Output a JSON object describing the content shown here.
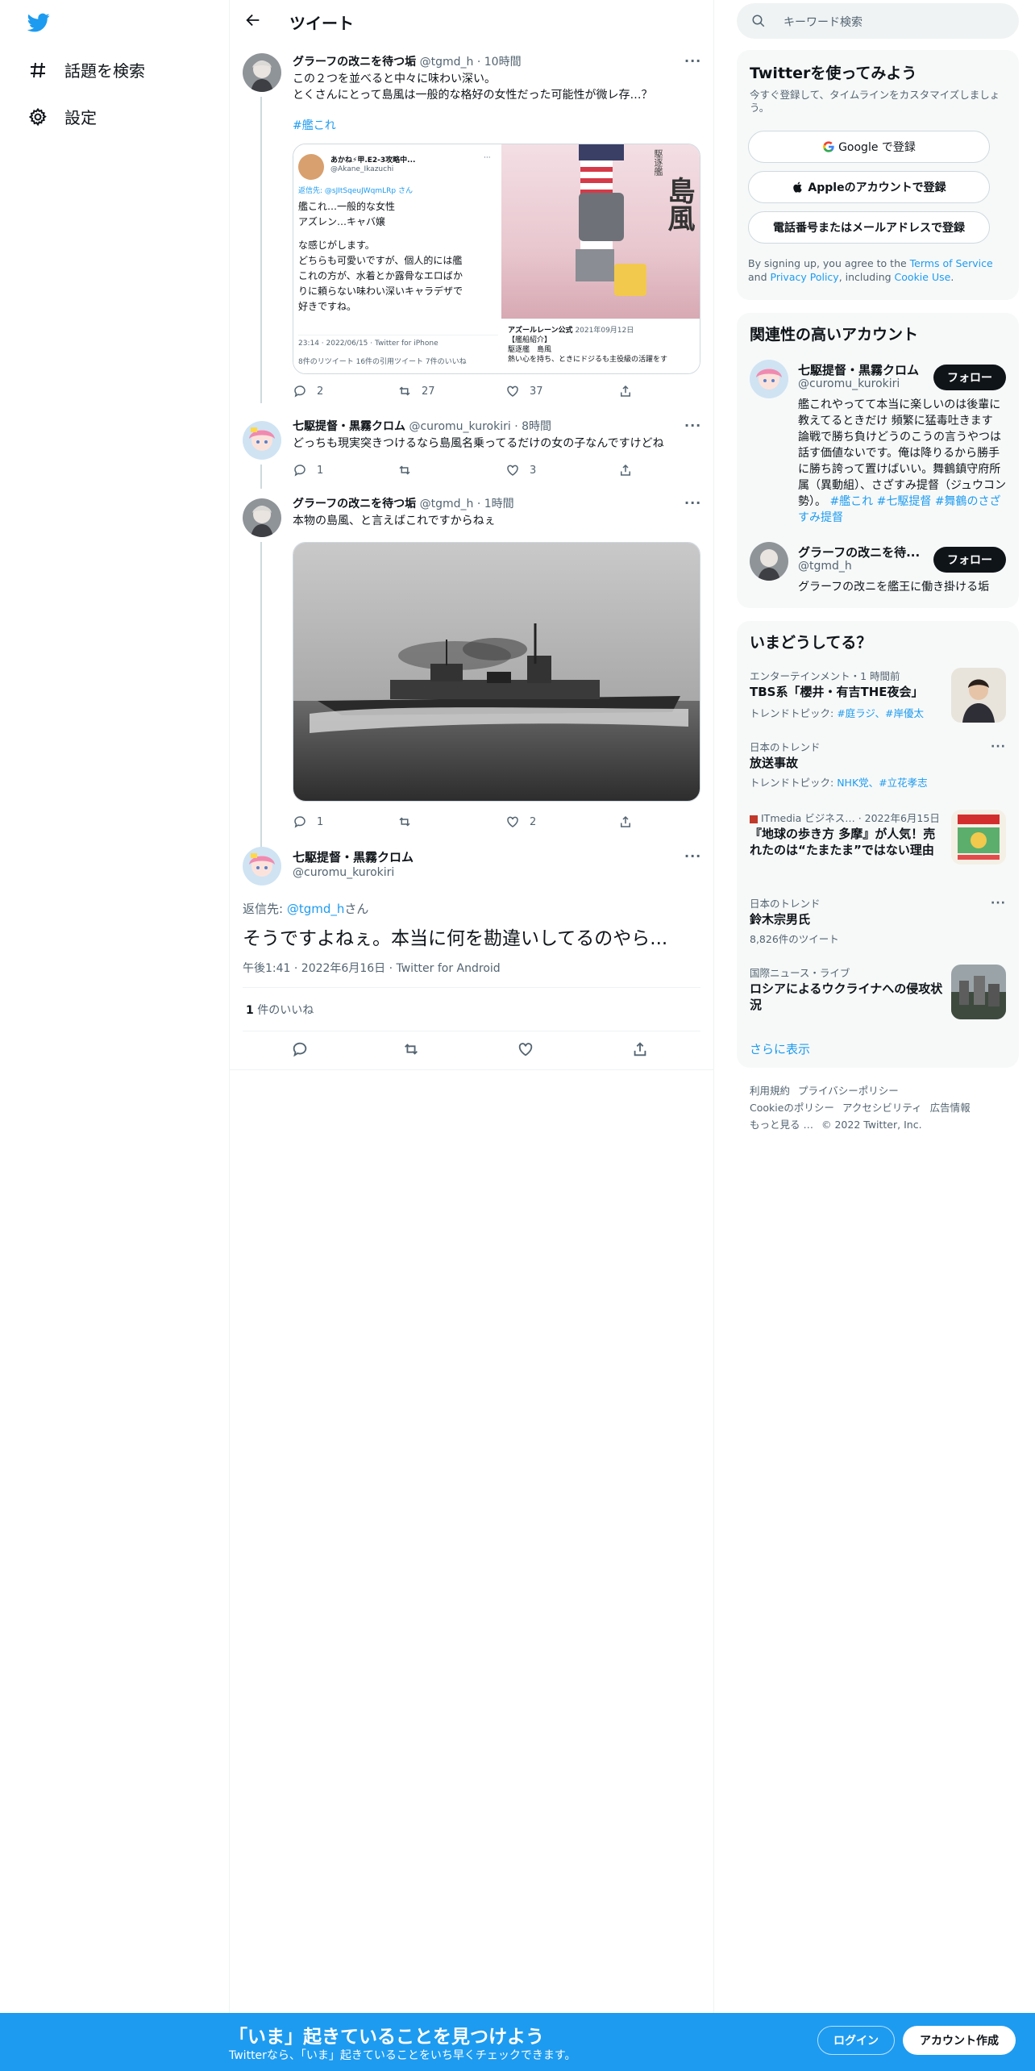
{
  "nav": {
    "logo": "twitter-bird",
    "items": [
      {
        "label": "話題を検索",
        "icon": "hashtag-icon"
      },
      {
        "label": "設定",
        "icon": "gear-icon"
      }
    ]
  },
  "header": {
    "title": "ツイート"
  },
  "tweets": [
    {
      "name": "グラーフの改ニを待つ垢",
      "handle": "@tgmd_h",
      "time": "10時間",
      "text1": "この２つを並べると中々に味わい深い。",
      "text2": "とくさんにとって島風は一般的な格好の女性だった可能性が微レ存…？",
      "hashtag": "#艦これ",
      "quote": {
        "user": "あかね⚡甲.E2-3攻略中...",
        "handle": "@Akane_Ikazuchi",
        "reply": "返信先: @sJItSqeuJWqmLRp さん",
        "lines": [
          "艦これ…一般的な女性",
          "アズレン…キャバ嬢",
          "",
          "な感じがします。",
          "どちらも可愛いですが、個人的には艦",
          "これの方が、水着とか露骨なエロばか",
          "りに頼らない味わい深いキャラデザで",
          "好きですね。"
        ],
        "footer": "23:14 · 2022/06/15 · Twitter for iPhone",
        "stats": "8件のリツイート  16件の引用ツイート  7件のいいね",
        "poster_title": "島風",
        "poster_sub": "駆逐艦",
        "inner_name": "アズールレーン公式",
        "inner_date": "2021年09月12日",
        "inner_line1": "【艦船紹介】",
        "inner_line2": "駆逐艦　島風",
        "inner_line3": "熱い心を持ち、ときにドジるも主役級の活躍をす"
      },
      "replies": "2",
      "retweets": "27",
      "likes": "37"
    },
    {
      "name": "七駆提督・黒霧クロム",
      "handle": "@curomu_kurokiri",
      "time": "8時間",
      "text1": "どっちも現実突きつけるなら島風名乗ってるだけの女の子なんですけどね",
      "replies": "1",
      "retweets": "",
      "likes": "3"
    },
    {
      "name": "グラーフの改ニを待つ垢",
      "handle": "@tgmd_h",
      "time": "1時間",
      "text1": "本物の島風、と言えばこれですからねぇ",
      "replies": "1",
      "retweets": "",
      "likes": "2"
    }
  ],
  "focus": {
    "name": "七駆提督・黒霧クロム",
    "handle": "@curomu_kurokiri",
    "reply_prefix": "返信先: ",
    "reply_handle": "@tgmd_h",
    "reply_suffix": "さん",
    "text": "そうですよねぇ。本当に何を勘違いしてるのやら...",
    "meta": "午後1:41 · 2022年6月16日 · Twitter for Android",
    "likes_count": "1",
    "likes_label": " 件のいいね"
  },
  "right": {
    "search_placeholder": "キーワード検索",
    "signup": {
      "title": "Twitterを使ってみよう",
      "sub": "今すぐ登録して、タイムラインをカスタマイズしましょう。",
      "google": "Google で登録",
      "apple": "Appleのアカウントで登録",
      "phone": "電話番号またはメールアドレスで登録",
      "terms_1": "By signing up, you agree to the ",
      "terms_tos": "Terms of Service",
      "terms_2": " and ",
      "terms_pp": "Privacy Policy",
      "terms_3": ", including ",
      "terms_cookie": "Cookie Use",
      "terms_4": "."
    },
    "related": {
      "title": "関連性の高いアカウント",
      "follow": "フォロー",
      "accounts": [
        {
          "name": "七駆提督・黒霧クロム",
          "handle": "@curomu_kurokiri",
          "bio": "艦これやってて本当に楽しいのは後輩に教えてるときだけ 頻繁に猛毒吐きます 論戦で勝ち負けどうのこうの言うやつは話す価値ないです。俺は降りるから勝手に勝ち誇って置けばいい。舞鶴鎮守府所属（異動組）、さざすみ提督（ジュウコン勢）。",
          "tags": "#艦これ #七駆提督 #舞鶴のさざすみ提督"
        },
        {
          "name": "グラーフの改ニを待...",
          "handle": "@tgmd_h",
          "bio": "グラーフの改ニを艦王に働き掛ける垢"
        }
      ]
    },
    "trends": {
      "title": "いまどうしてる？",
      "items": [
        {
          "meta": "エンターテインメント・1 時間前",
          "title": "TBS系「櫻井・有吉THE夜会」",
          "sub_prefix": "トレンドトピック: ",
          "sub_links": "#庭ラジ、#岸優太",
          "thumb": "person"
        },
        {
          "meta": "日本のトレンド",
          "title": "放送事故",
          "sub_prefix": "トレンドトピック: ",
          "sub_links": "NHK党、#立花孝志",
          "more": "···"
        },
        {
          "meta": "ITmedia ビジネス… · 2022年6月15日",
          "title": "『地球の歩き方 多摩』が人気！売れたのは“たまたま”ではない理由",
          "thumb": "book"
        },
        {
          "meta": "日本のトレンド",
          "title": "鈴木宗男氏",
          "sub_plain": "8,826件のツイート",
          "more": "···"
        },
        {
          "meta": "国際ニュース・ライブ",
          "title": "ロシアによるウクライナへの侵攻状況",
          "thumb": "city"
        }
      ],
      "show_more": "さらに表示"
    },
    "footer": {
      "line1": [
        "利用規約",
        "プライバシーポリシー"
      ],
      "line2": [
        "Cookieのポリシー",
        "アクセシビリティ",
        "広告情報"
      ],
      "line3": [
        "もっと見る …",
        "© 2022 Twitter, Inc."
      ]
    }
  },
  "bottombar": {
    "title": "「いま」起きていることを見つけよう",
    "sub": "Twitterなら、「いま」起きていることをいち早くチェックできます。",
    "login": "ログイン",
    "signup": "アカウント作成"
  },
  "colors": {
    "accent": "#1d9bf0",
    "text": "#0f1419",
    "muted": "#536471",
    "border": "#eff3f4"
  }
}
